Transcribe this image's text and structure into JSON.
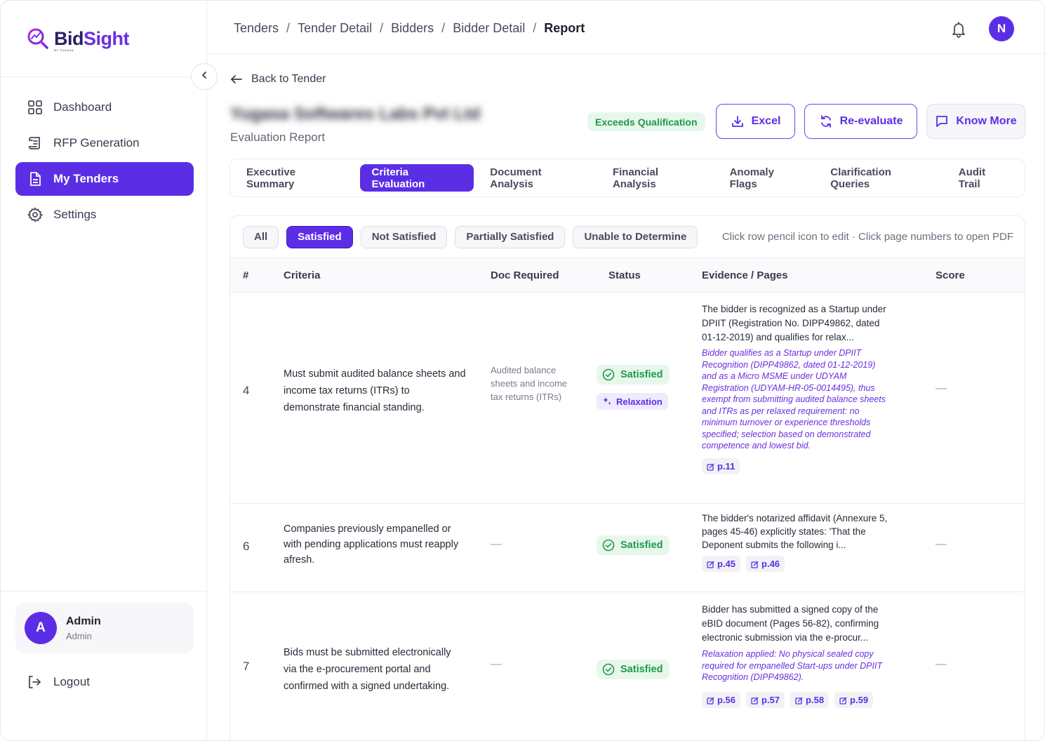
{
  "brand": {
    "name_part1": "Bid",
    "name_part2": "Sight",
    "tagline": "BY YUGASA"
  },
  "sidebar": {
    "items": [
      {
        "label": "Dashboard",
        "icon": "grid-icon"
      },
      {
        "label": "RFP Generation",
        "icon": "scroll-icon"
      },
      {
        "label": "My Tenders",
        "icon": "document-icon",
        "active": true
      },
      {
        "label": "Settings",
        "icon": "gear-icon"
      }
    ],
    "user": {
      "initial": "A",
      "name": "Admin",
      "role": "Admin"
    },
    "logout_label": "Logout"
  },
  "header": {
    "breadcrumb": [
      "Tenders",
      "Tender Detail",
      "Bidders",
      "Bidder Detail",
      "Report"
    ],
    "breadcrumb_sep": "/",
    "avatar_initial": "N"
  },
  "report": {
    "back_label": "Back to Tender",
    "company_name": "Yugasa Softwares Labs Pvt Ltd",
    "subtitle": "Evaluation Report",
    "qualification_badge": "Exceeds Qualification",
    "buttons": {
      "excel": "Excel",
      "reevaluate": "Re-evaluate",
      "know_more": "Know More"
    }
  },
  "tabs": [
    "Executive Summary",
    "Criteria Evaluation",
    "Document Analysis",
    "Financial Analysis",
    "Anomaly Flags",
    "Clarification Queries",
    "Audit Trail"
  ],
  "active_tab": "Criteria Evaluation",
  "filters": {
    "chips": [
      "All",
      "Satisfied",
      "Not Satisfied",
      "Partially Satisfied",
      "Unable to Determine"
    ],
    "active": "Satisfied",
    "hint": "Click row pencil icon to edit · Click page numbers to open PDF"
  },
  "table": {
    "columns": [
      "#",
      "Criteria",
      "Doc Required",
      "Status",
      "Evidence / Pages",
      "Score"
    ],
    "rows": [
      {
        "num": "4",
        "criteria": "Must submit audited balance sheets and income tax returns (ITRs) to demonstrate financial standing.",
        "doc_required": "Audited balance sheets and income tax returns (ITRs)",
        "status": "Satisfied",
        "relaxation": "Relaxation",
        "evidence": "The bidder is recognized as a Startup under DPIIT (Registration No. DIPP49862, dated 01-12-2019) and qualifies for relax...",
        "note": "Bidder qualifies as a Startup under DPIIT Recognition (DIPP49862, dated 01-12-2019) and as a Micro MSME under UDYAM Registration (UDYAM-HR-05-0014495), thus exempt from submitting audited balance sheets and ITRs as per relaxed requirement: no minimum turnover or experience thresholds specified; selection based on demonstrated competence and lowest bid.",
        "pages": [
          "p.11"
        ],
        "score": "—"
      },
      {
        "num": "6",
        "criteria": "Companies previously empanelled or with pending applications must reapply afresh.",
        "doc_required": "—",
        "status": "Satisfied",
        "evidence": "The bidder's notarized affidavit (Annexure 5, pages 45-46) explicitly states: 'That the Deponent submits the following i...",
        "pages": [
          "p.45",
          "p.46"
        ],
        "score": "—"
      },
      {
        "num": "7",
        "criteria": "Bids must be submitted electronically via the e-procurement portal and confirmed with a signed undertaking.",
        "doc_required": "—",
        "status": "Satisfied",
        "evidence": "Bidder has submitted a signed copy of the eBID document (Pages 56-82), confirming electronic submission via the e-procur...",
        "note": "Relaxation applied: No physical sealed copy required for empanelled Start-ups under DPIIT Recognition (DIPP49862).",
        "pages": [
          "p.56",
          "p.57",
          "p.58",
          "p.59"
        ],
        "score": "—"
      }
    ]
  },
  "colors": {
    "primary": "#5b2ee6",
    "success": "#1f9a4b",
    "success_bg": "#e7f7ec"
  }
}
